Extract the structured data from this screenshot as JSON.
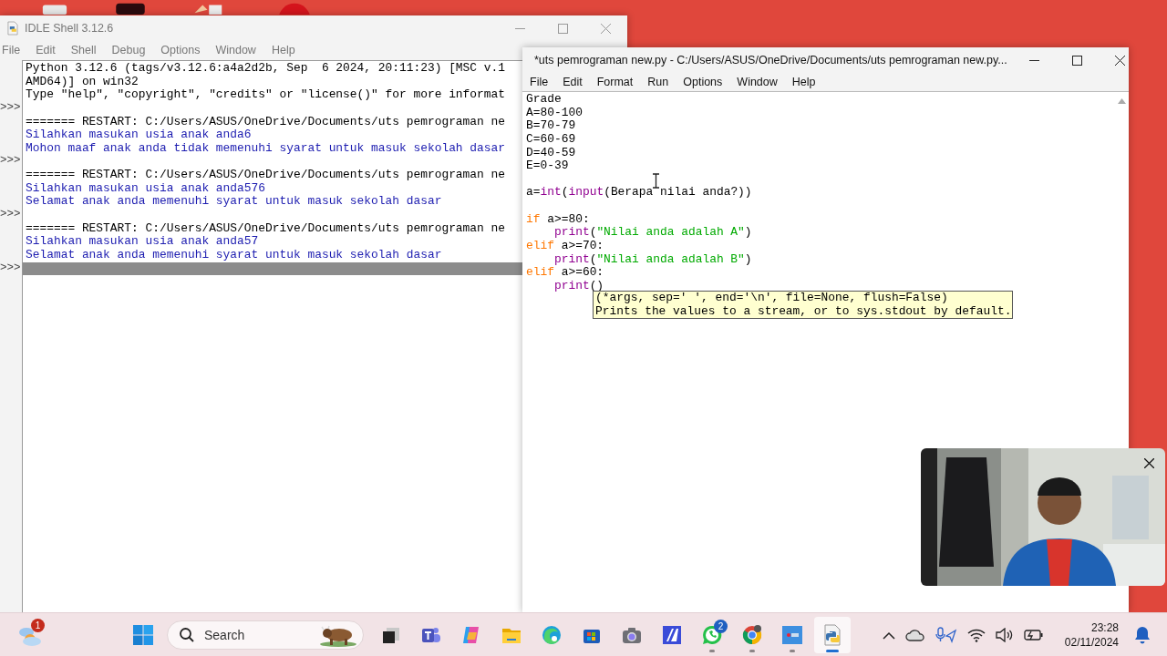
{
  "shell": {
    "title": "IDLE Shell 3.12.6",
    "menu": [
      "File",
      "Edit",
      "Shell",
      "Debug",
      "Options",
      "Window",
      "Help"
    ],
    "lines": [
      {
        "kind": "info",
        "text": "Python 3.12.6 (tags/v3.12.6:a4a2d2b, Sep  6 2024, 20:11:23) [MSC v.1"
      },
      {
        "kind": "info",
        "text": "AMD64)] on win32"
      },
      {
        "kind": "info",
        "text": "Type \"help\", \"copyright\", \"credits\" or \"license()\" for more informat"
      },
      {
        "kind": "blank",
        "prompt": ">>>"
      },
      {
        "kind": "info",
        "text": "======= RESTART: C:/Users/ASUS/OneDrive/Documents/uts pemrograman ne"
      },
      {
        "kind": "output",
        "text": "Silahkan masukan usia anak anda6"
      },
      {
        "kind": "output",
        "text": "Mohon maaf anak anda tidak memenuhi syarat untuk masuk sekolah dasar"
      },
      {
        "kind": "blank",
        "prompt": ">>>"
      },
      {
        "kind": "info",
        "text": "======= RESTART: C:/Users/ASUS/OneDrive/Documents/uts pemrograman ne"
      },
      {
        "kind": "output",
        "text": "Silahkan masukan usia anak anda576"
      },
      {
        "kind": "output",
        "text": "Selamat anak anda memenuhi syarat untuk masuk sekolah dasar"
      },
      {
        "kind": "blank",
        "prompt": ">>>"
      },
      {
        "kind": "info",
        "text": "======= RESTART: C:/Users/ASUS/OneDrive/Documents/uts pemrograman ne"
      },
      {
        "kind": "output",
        "text": "Silahkan masukan usia anak anda57"
      },
      {
        "kind": "output",
        "text": "Selamat anak anda memenuhi syarat untuk masuk sekolah dasar"
      },
      {
        "kind": "current",
        "prompt": ">>>"
      }
    ]
  },
  "editor": {
    "title": "*uts pemrograman new.py - C:/Users/ASUS/OneDrive/Documents/uts pemrograman new.py...",
    "menu": [
      "File",
      "Edit",
      "Format",
      "Run",
      "Options",
      "Window",
      "Help"
    ],
    "lines": [
      {
        "kind": "code",
        "tokens": [
          {
            "kind": "plain",
            "text": "Grade"
          }
        ]
      },
      {
        "kind": "code",
        "tokens": [
          {
            "kind": "plain",
            "text": "A=80-100"
          }
        ]
      },
      {
        "kind": "code",
        "tokens": [
          {
            "kind": "plain",
            "text": "B=70-79"
          }
        ]
      },
      {
        "kind": "code",
        "tokens": [
          {
            "kind": "plain",
            "text": "C=60-69"
          }
        ]
      },
      {
        "kind": "code",
        "tokens": [
          {
            "kind": "plain",
            "text": "D=40-59"
          }
        ]
      },
      {
        "kind": "code",
        "tokens": [
          {
            "kind": "plain",
            "text": "E=0-39"
          }
        ]
      },
      {
        "kind": "blank"
      },
      {
        "kind": "code",
        "tokens": [
          {
            "kind": "plain",
            "text": "a="
          },
          {
            "kind": "builtin",
            "text": "int"
          },
          {
            "kind": "plain",
            "text": "("
          },
          {
            "kind": "builtin",
            "text": "input"
          },
          {
            "kind": "plain",
            "text": "(Berapa nilai anda?))"
          }
        ]
      },
      {
        "kind": "blank"
      },
      {
        "kind": "code",
        "tokens": [
          {
            "kind": "keyword",
            "text": "if"
          },
          {
            "kind": "plain",
            "text": " a>=80:"
          }
        ]
      },
      {
        "kind": "indented",
        "tokens": [
          {
            "kind": "builtin",
            "text": "print"
          },
          {
            "kind": "plain",
            "text": "("
          },
          {
            "kind": "string",
            "text": "\"Nilai anda adalah A\""
          },
          {
            "kind": "plain",
            "text": ")"
          }
        ]
      },
      {
        "kind": "code",
        "tokens": [
          {
            "kind": "keyword",
            "text": "elif"
          },
          {
            "kind": "plain",
            "text": " a>=70:"
          }
        ]
      },
      {
        "kind": "indented",
        "tokens": [
          {
            "kind": "builtin",
            "text": "print"
          },
          {
            "kind": "plain",
            "text": "("
          },
          {
            "kind": "string",
            "text": "\"Nilai anda adalah B\""
          },
          {
            "kind": "plain",
            "text": ")"
          }
        ]
      },
      {
        "kind": "code",
        "tokens": [
          {
            "kind": "keyword",
            "text": "elif"
          },
          {
            "kind": "plain",
            "text": " a>=60:"
          }
        ]
      },
      {
        "kind": "indented",
        "tokens": [
          {
            "kind": "builtin",
            "text": "print"
          },
          {
            "kind": "plain",
            "text": "()"
          }
        ]
      }
    ],
    "calltip": [
      "(*args, sep=' ', end='\\n', file=None, flush=False)",
      "Prints the values to a stream, or to sys.stdout by default."
    ]
  },
  "taskbar": {
    "weather_badge": "1",
    "search": {
      "label": "Search"
    },
    "apps": [
      {
        "running": false,
        "selected": false
      },
      {
        "running": false,
        "selected": false
      },
      {
        "running": false,
        "selected": false
      },
      {
        "running": false,
        "selected": false
      },
      {
        "running": false,
        "selected": false
      },
      {
        "running": false,
        "selected": false
      },
      {
        "running": false,
        "selected": false
      },
      {
        "running": false,
        "selected": false
      },
      {
        "running": true,
        "selected": false,
        "badge": "2"
      },
      {
        "running": true,
        "selected": false
      },
      {
        "running": true,
        "selected": false
      },
      {
        "running": true,
        "selected": true
      }
    ],
    "time": "23:28",
    "date": "02/11/2024"
  }
}
